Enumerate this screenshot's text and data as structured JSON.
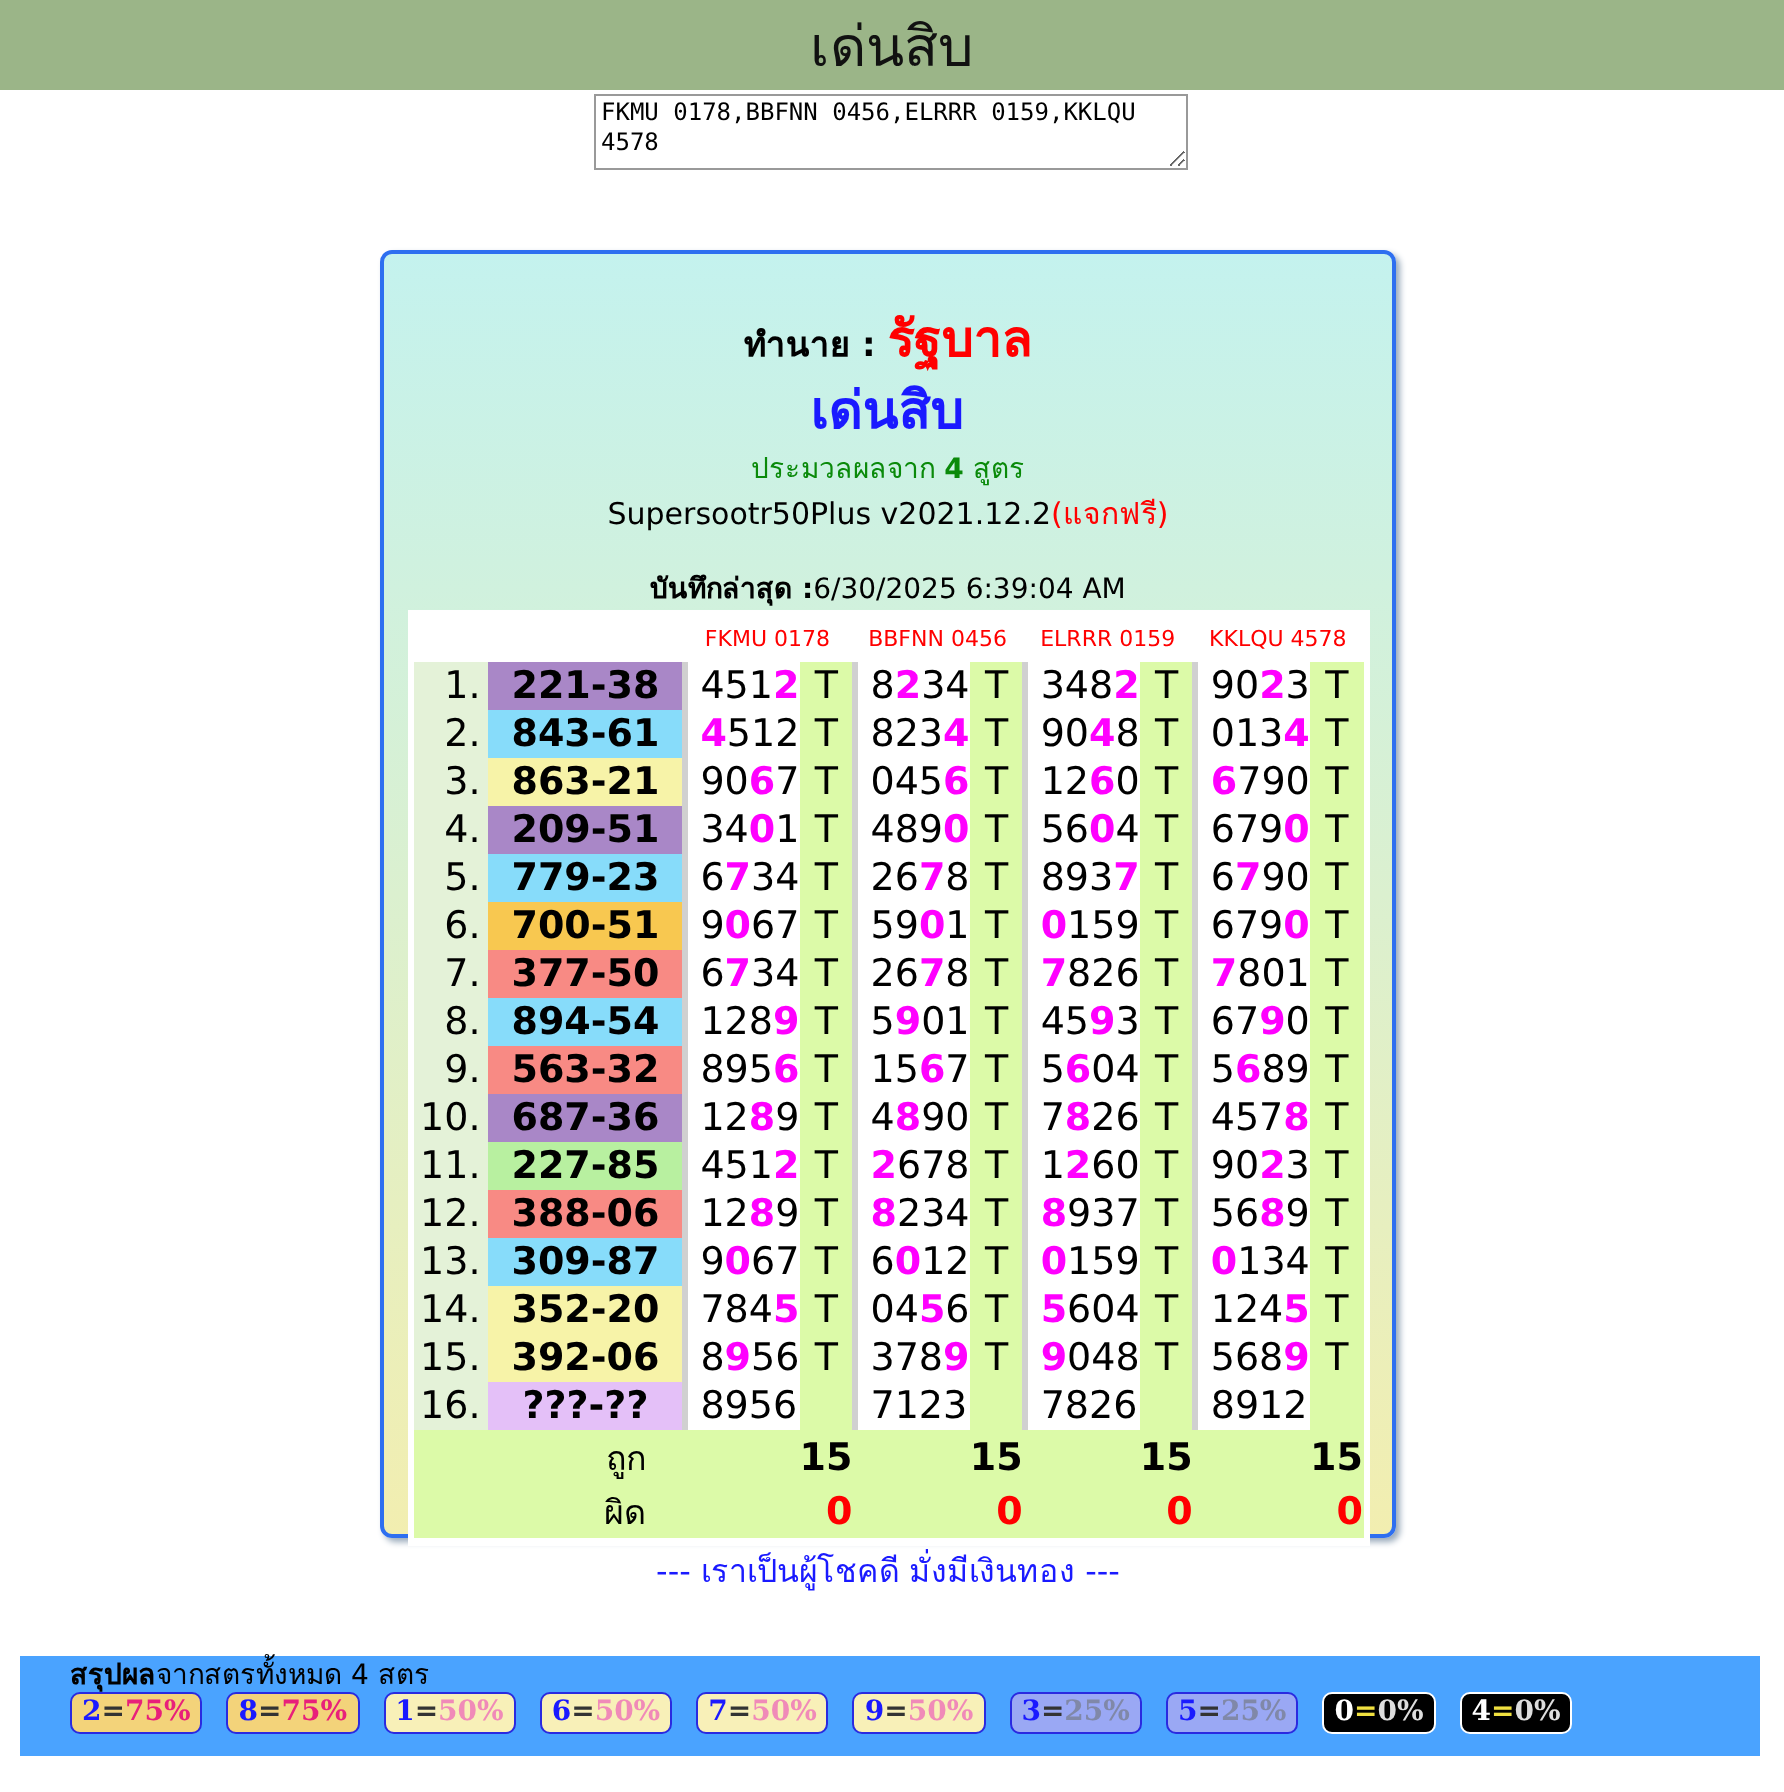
{
  "header": {
    "title": "เด่นสิบ"
  },
  "formula_input": {
    "value": "FKMU 0178,BBFNN 0456,ELRRR 0159,KKLQU 4578"
  },
  "card": {
    "predict_label": "ทำนาย :",
    "lottery": "รัฐบาล",
    "title": "เด่นสิบ",
    "subtitle": "ประมวลผลจาก **4** สูตร",
    "version": "Supersootr50Plus v2021.12.2",
    "free_note": "(แจกฟรี)",
    "saved_label": "บันทึกล่าสุด :",
    "saved_time": "6/30/2025 6:39:04 AM"
  },
  "table": {
    "columns": [
      "FKMU 0178",
      "BBFNN 0456",
      "ELRRR 0159",
      "KKLQU 4578"
    ],
    "rows": [
      {
        "index": "1.",
        "number": "221-38",
        "color": "#a987c7",
        "cells": [
          {
            "value": "451**2**",
            "mark": "T"
          },
          {
            "value": "8**2**34",
            "mark": "T"
          },
          {
            "value": "348**2**",
            "mark": "T"
          },
          {
            "value": "90**2**3",
            "mark": "T"
          }
        ]
      },
      {
        "index": "2.",
        "number": "843-61",
        "color": "#87dcfa",
        "cells": [
          {
            "value": "**4**512",
            "mark": "T"
          },
          {
            "value": "823**4**",
            "mark": "T"
          },
          {
            "value": "90**4**8",
            "mark": "T"
          },
          {
            "value": "013**4**",
            "mark": "T"
          }
        ]
      },
      {
        "index": "3.",
        "number": "863-21",
        "color": "#f7f3a8",
        "cells": [
          {
            "value": "90**6**7",
            "mark": "T"
          },
          {
            "value": "045**6**",
            "mark": "T"
          },
          {
            "value": "12**6**0",
            "mark": "T"
          },
          {
            "value": "**6**790",
            "mark": "T"
          }
        ]
      },
      {
        "index": "4.",
        "number": "209-51",
        "color": "#a987c7",
        "cells": [
          {
            "value": "34**0**1",
            "mark": "T"
          },
          {
            "value": "489**0**",
            "mark": "T"
          },
          {
            "value": "56**0**4",
            "mark": "T"
          },
          {
            "value": "679**0**",
            "mark": "T"
          }
        ]
      },
      {
        "index": "5.",
        "number": "779-23",
        "color": "#87dcfa",
        "cells": [
          {
            "value": "6**7**34",
            "mark": "T"
          },
          {
            "value": "26**7**8",
            "mark": "T"
          },
          {
            "value": "893**7**",
            "mark": "T"
          },
          {
            "value": "6**7**90",
            "mark": "T"
          }
        ]
      },
      {
        "index": "6.",
        "number": "700-51",
        "color": "#f8c850",
        "cells": [
          {
            "value": "9**0**67",
            "mark": "T"
          },
          {
            "value": "59**0**1",
            "mark": "T"
          },
          {
            "value": "**0**159",
            "mark": "T"
          },
          {
            "value": "679**0**",
            "mark": "T"
          }
        ]
      },
      {
        "index": "7.",
        "number": "377-50",
        "color": "#f88a84",
        "cells": [
          {
            "value": "6**7**34",
            "mark": "T"
          },
          {
            "value": "26**7**8",
            "mark": "T"
          },
          {
            "value": "**7**826",
            "mark": "T"
          },
          {
            "value": "**7**801",
            "mark": "T"
          }
        ]
      },
      {
        "index": "8.",
        "number": "894-54",
        "color": "#87dcfa",
        "cells": [
          {
            "value": "128**9**",
            "mark": "T"
          },
          {
            "value": "5**9**01",
            "mark": "T"
          },
          {
            "value": "45**9**3",
            "mark": "T"
          },
          {
            "value": "67**9**0",
            "mark": "T"
          }
        ]
      },
      {
        "index": "9.",
        "number": "563-32",
        "color": "#f88a84",
        "cells": [
          {
            "value": "895**6**",
            "mark": "T"
          },
          {
            "value": "15**6**7",
            "mark": "T"
          },
          {
            "value": "5**6**04",
            "mark": "T"
          },
          {
            "value": "5**6**89",
            "mark": "T"
          }
        ]
      },
      {
        "index": "10.",
        "number": "687-36",
        "color": "#a987c7",
        "cells": [
          {
            "value": "12**8**9",
            "mark": "T"
          },
          {
            "value": "4**8**90",
            "mark": "T"
          },
          {
            "value": "7**8**26",
            "mark": "T"
          },
          {
            "value": "457**8**",
            "mark": "T"
          }
        ]
      },
      {
        "index": "11.",
        "number": "227-85",
        "color": "#b8f0a0",
        "cells": [
          {
            "value": "451**2**",
            "mark": "T"
          },
          {
            "value": "**2**678",
            "mark": "T"
          },
          {
            "value": "1**2**60",
            "mark": "T"
          },
          {
            "value": "90**2**3",
            "mark": "T"
          }
        ]
      },
      {
        "index": "12.",
        "number": "388-06",
        "color": "#f88a84",
        "cells": [
          {
            "value": "12**8**9",
            "mark": "T"
          },
          {
            "value": "**8**234",
            "mark": "T"
          },
          {
            "value": "**8**937",
            "mark": "T"
          },
          {
            "value": "56**8**9",
            "mark": "T"
          }
        ]
      },
      {
        "index": "13.",
        "number": "309-87",
        "color": "#87dcfa",
        "cells": [
          {
            "value": "9**0**67",
            "mark": "T"
          },
          {
            "value": "6**0**12",
            "mark": "T"
          },
          {
            "value": "**0**159",
            "mark": "T"
          },
          {
            "value": "**0**134",
            "mark": "T"
          }
        ]
      },
      {
        "index": "14.",
        "number": "352-20",
        "color": "#f7f3a8",
        "cells": [
          {
            "value": "784**5**",
            "mark": "T"
          },
          {
            "value": "04**5**6",
            "mark": "T"
          },
          {
            "value": "**5**604",
            "mark": "T"
          },
          {
            "value": "124**5**",
            "mark": "T"
          }
        ]
      },
      {
        "index": "15.",
        "number": "392-06",
        "color": "#f7f3a8",
        "cells": [
          {
            "value": "8**9**56",
            "mark": "T"
          },
          {
            "value": "378**9**",
            "mark": "T"
          },
          {
            "value": "**9**048",
            "mark": "T"
          },
          {
            "value": "568**9**",
            "mark": "T"
          }
        ]
      },
      {
        "index": "16.",
        "number": "???-??",
        "color": "#e4c0f8",
        "cells": [
          {
            "value": "8956"
          },
          {
            "value": "7123"
          },
          {
            "value": "7826"
          },
          {
            "value": "8912"
          }
        ]
      }
    ],
    "totals": [
      {
        "label": "ถูก",
        "kind": "correct",
        "values": [
          "15",
          "15",
          "15",
          "15"
        ]
      },
      {
        "label": "ผิด",
        "kind": "wrong",
        "values": [
          "0",
          "0",
          "0",
          "0"
        ]
      }
    ]
  },
  "motto": "--- เราเป็นผู้โชคดี มั่งมีเงินทอง ---",
  "summary": {
    "label": "สรุปผล",
    "text": "จากสตรทั้งหมด 4 สตร",
    "chips": [
      {
        "digit": "2",
        "sign": "=",
        "percent": "75%",
        "kind": "high"
      },
      {
        "digit": "8",
        "sign": "=",
        "percent": "75%",
        "kind": "high"
      },
      {
        "digit": "1",
        "sign": "=",
        "percent": "50%",
        "kind": "mid"
      },
      {
        "digit": "6",
        "sign": "=",
        "percent": "50%",
        "kind": "mid"
      },
      {
        "digit": "7",
        "sign": "=",
        "percent": "50%",
        "kind": "mid"
      },
      {
        "digit": "9",
        "sign": "=",
        "percent": "50%",
        "kind": "mid"
      },
      {
        "digit": "3",
        "sign": "=",
        "percent": "25%",
        "kind": "low"
      },
      {
        "digit": "5",
        "sign": "=",
        "percent": "25%",
        "kind": "low"
      },
      {
        "digit": "0",
        "sign": "=",
        "percent": "0%",
        "kind": "zero"
      },
      {
        "digit": "4",
        "sign": "=",
        "percent": "0%",
        "kind": "zero"
      }
    ]
  }
}
